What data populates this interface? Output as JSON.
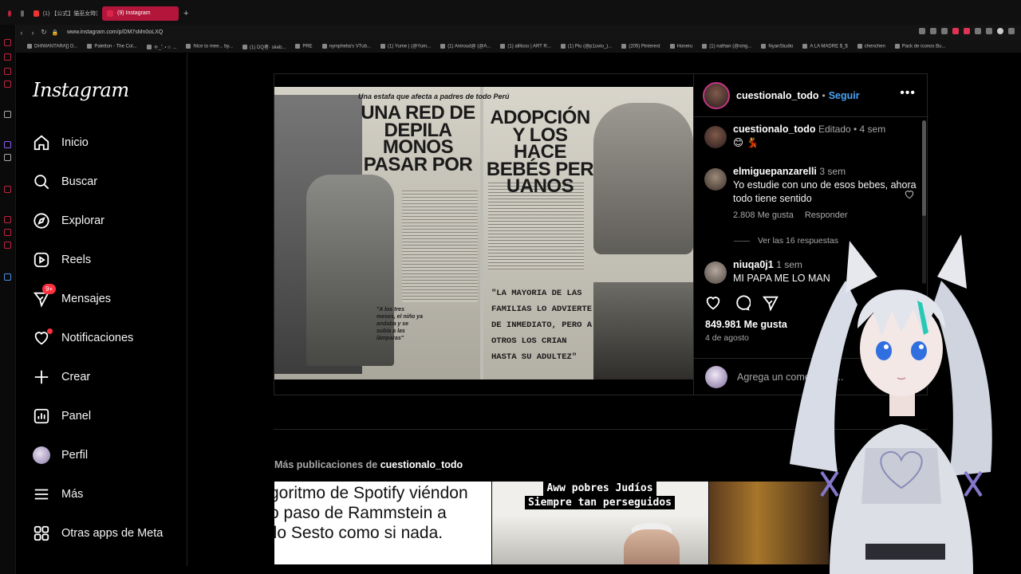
{
  "browser": {
    "tabs": [
      {
        "label": "(1) 【公式】猫巫女時計 fu"
      },
      {
        "label": "(9) Instagram"
      }
    ],
    "url": "www.instagram.com/p/DM7sMn0oLXQ",
    "bookmarks": [
      "DHIWANTARA]] O...",
      "Paletton - The Col...",
      "ゃ_˚.⋆☆ ...",
      "Nice to mee... by...",
      "(1) DQ者· skeb...",
      "PRE",
      "nymphelia's VTub...",
      "(1) Yume | (@Yum...",
      "(1) Aniroud@ (@A...",
      "(1) aillisso | ART R...",
      "(1) Piu (@p1uvio_)...",
      "(205) Pinterest",
      "Honeru",
      "(1) nathan (@sing...",
      "NyanStudio",
      "A LA MADRE $_$",
      "chenchen",
      "Pack de iconos Bu..."
    ]
  },
  "sidebar": {
    "logo": "Instagram",
    "items": [
      {
        "label": "Inicio"
      },
      {
        "label": "Buscar"
      },
      {
        "label": "Explorar"
      },
      {
        "label": "Reels"
      },
      {
        "label": "Mensajes",
        "badge": "9+"
      },
      {
        "label": "Notificaciones"
      },
      {
        "label": "Crear"
      },
      {
        "label": "Panel"
      },
      {
        "label": "Perfil"
      },
      {
        "label": "Más"
      },
      {
        "label": "Otras apps de Meta"
      }
    ]
  },
  "post": {
    "image_text": {
      "top": "Una estafa que afecta a padres de todo Perú",
      "left_headline": "UNA RED DE DEPILA MONOS PASAR POR",
      "right_headline": "ADOPCIÓN Y LOS HACE BEBÉS PER UANOS",
      "quote_right": "\"LA MAYORIA DE LAS FAMILIAS LO ADVIERTE DE INMEDIATO, PERO A OTROS LOS CRIAN HASTA SU ADULTEZ\"",
      "quote_left": "\"A los tres meses, el niño ya andaba y se subía a las lámparas\""
    },
    "author": "cuestionalo_todo",
    "follow_label": "Seguir",
    "comments": [
      {
        "user": "cuestionalo_todo",
        "meta": "Editado • 4 sem",
        "text": "😊 💃"
      },
      {
        "user": "elmiguepanzarelli",
        "meta": "3 sem",
        "text": "Yo estudie con uno de esos bebes, ahora todo tiene sentido",
        "likes": "2.808 Me gusta",
        "reply": "Responder"
      },
      {
        "user": "niuqa0j1",
        "meta": "1 sem",
        "text": "MI PAPA ME LO MAN"
      }
    ],
    "view_replies": "Ver las 16 respuestas",
    "likes": "849.981 Me gusta",
    "date": "4 de agosto",
    "add_comment_placeholder": "Agrega un comentario..."
  },
  "more_posts": {
    "prefix": "Más publicaciones de ",
    "user": "cuestionalo_todo",
    "thumb1_lines": [
      "goritmo de Spotify viéndon",
      "o paso de Rammstein a",
      "ilo Sesto como si nada."
    ],
    "thumb2_lines": [
      "Aww pobres Judíos",
      "Siempre tan perseguidos"
    ]
  },
  "colors": {
    "accent_link": "#4aa3f5",
    "notification_red": "#ff3040",
    "tab_active": "#b3163a"
  }
}
